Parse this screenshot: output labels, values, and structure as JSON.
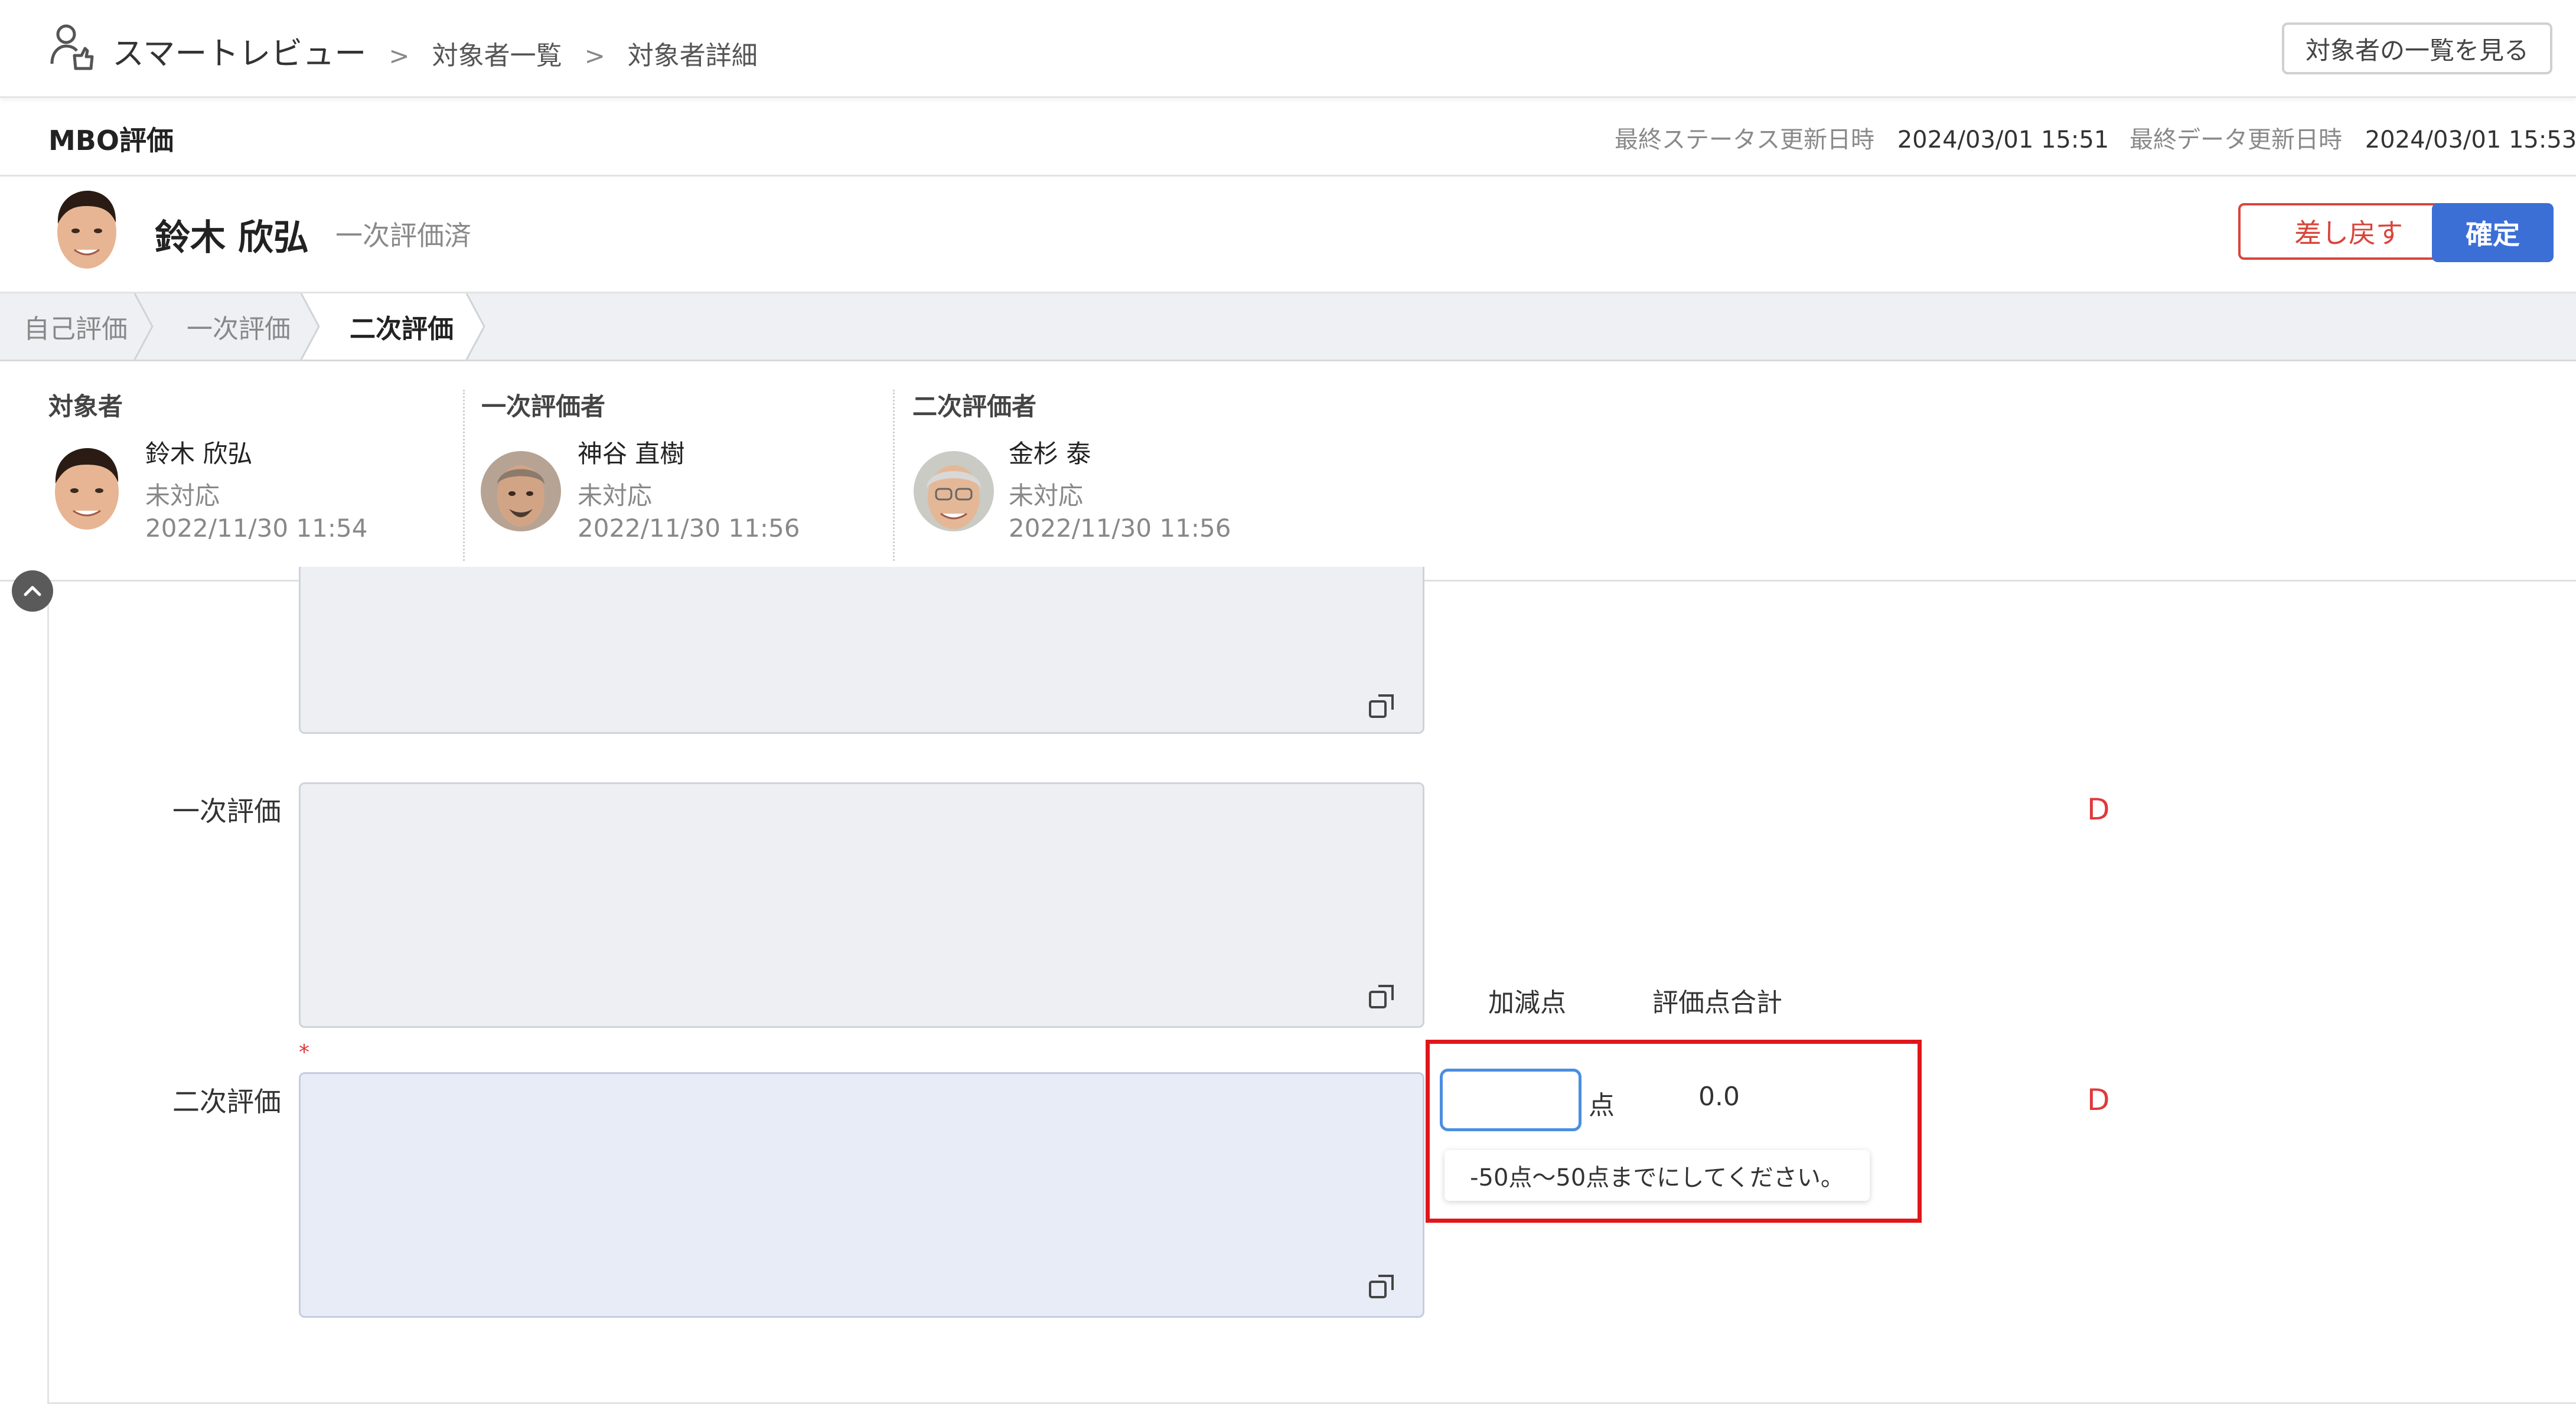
{
  "breadcrumb": {
    "app_name": "スマートレビュー",
    "items": [
      "対象者一覧",
      "対象者詳細"
    ],
    "separator": ">"
  },
  "header": {
    "list_button": "対象者の一覧を見る"
  },
  "mbo": {
    "title": "MBO評価",
    "status_updated_label": "最終ステータス更新日時",
    "status_updated_value": "2024/03/01 15:51",
    "data_updated_label": "最終データ更新日時",
    "data_updated_value": "2024/03/01 15:53"
  },
  "person": {
    "name": "鈴木 欣弘",
    "status": "一次評価済",
    "return_button": "差し戻す",
    "confirm_button": "確定"
  },
  "steps": [
    "自己評価",
    "一次評価",
    "二次評価"
  ],
  "evaluators": [
    {
      "role": "対象者",
      "name": "鈴木 欣弘",
      "status": "未対応",
      "date": "2022/11/30 11:54"
    },
    {
      "role": "一次評価者",
      "name": "神谷 直樹",
      "status": "未対応",
      "date": "2022/11/30 11:56"
    },
    {
      "role": "二次評価者",
      "name": "金杉 泰",
      "status": "未対応",
      "date": "2022/11/30 11:56"
    }
  ],
  "form": {
    "first_label": "一次評価",
    "second_label": "二次評価",
    "required_mark": "*",
    "first_grade": "D",
    "second_grade": "D",
    "adjust_header": "加減点",
    "total_header": "評価点合計",
    "unit": "点",
    "total_value": "0.0",
    "adjust_value": "",
    "tooltip": "-50点〜50点までにしてください。"
  },
  "colors": {
    "accent": "#3b6fd6",
    "danger": "#d9453b",
    "highlight": "#e0161b",
    "grade": "#e0393b"
  }
}
